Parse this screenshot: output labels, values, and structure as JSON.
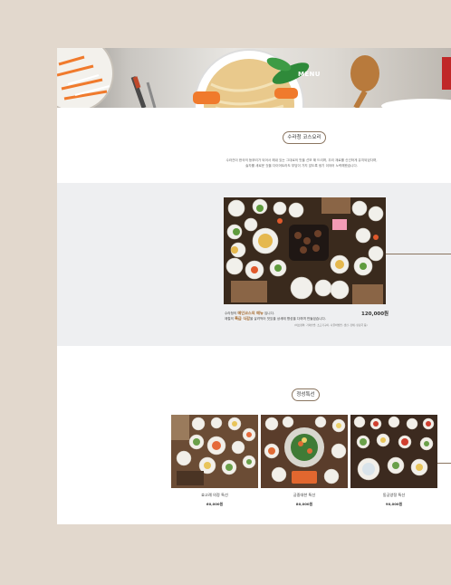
{
  "hero": {
    "title": "MENU"
  },
  "course": {
    "badge": "수라청 코스요리",
    "intro_lines": [
      "수라관이 한국의 등뿌리가 되어서 해내 있는 그대로의 맛을 선보 해 드리며, 우리 재료를 신선하게 유지되었다며,",
      "술자를 새로운 것을 다이어트라도 부담이 가지 않도록 생기 이야어 노력해왔습니다."
    ]
  },
  "main_menu": {
    "desc_prefix": "수라청의 ",
    "desc_highlight_1": "메인코스의 메뉴",
    "desc_suffix_1": " 입니다.",
    "desc_line2_prefix": "제철의 ",
    "desc_highlight_2": "특급 식감",
    "desc_line2_suffix": "을 살려먹어 맛있을 상세에 향성을 다하며 만들었습니다.",
    "price": "120,000원",
    "note": "(허브랫와, 가마솥밥, 소고기구이, 나물비빔밥, 생선, 잡채, 된장국 등)"
  },
  "set_menu": {
    "badge": "정성특선",
    "cards": [
      {
        "title": "효고례 의정 특선",
        "price": "60,000원"
      },
      {
        "title": "궁중대한 특선",
        "price": "80,000원"
      },
      {
        "title": "동궁양정 특선",
        "price": "90,000원"
      }
    ]
  },
  "colors": {
    "background": "#e2d8cd",
    "band": "#eeeff1",
    "accent": "#8a7560",
    "highlight": "#a66a2e"
  }
}
